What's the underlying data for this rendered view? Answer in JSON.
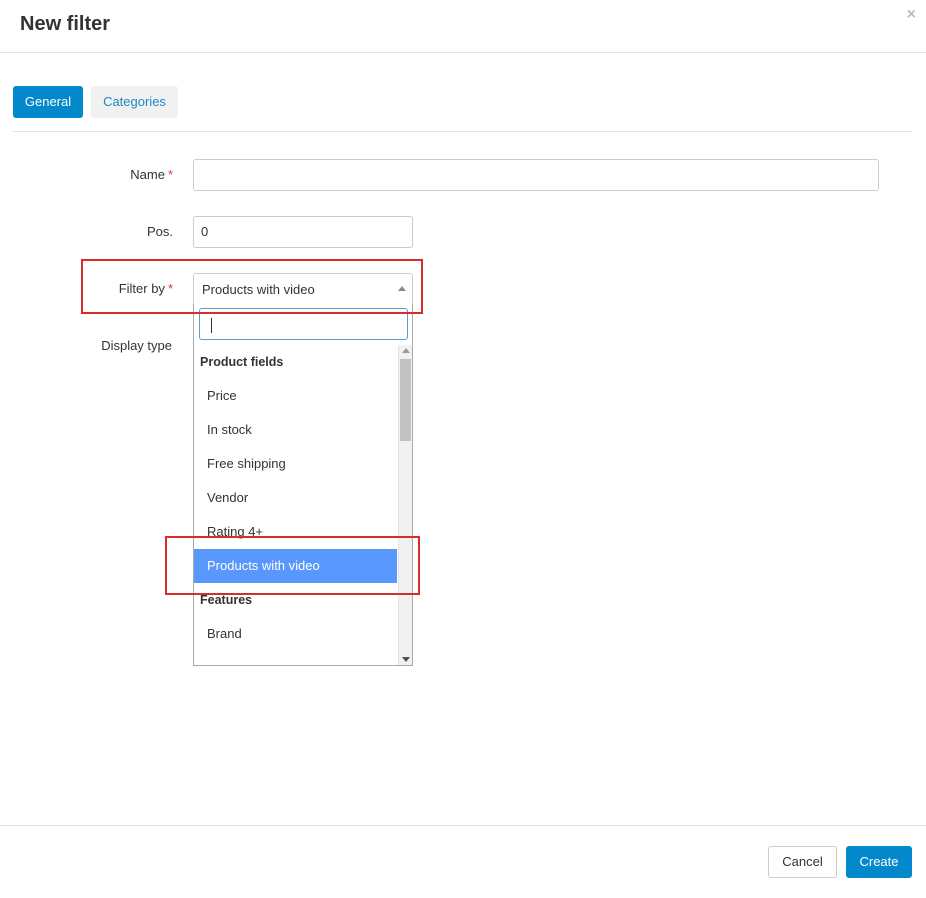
{
  "dialog": {
    "title": "New filter",
    "close_glyph": "×"
  },
  "tabs": [
    {
      "label": "General",
      "active": true
    },
    {
      "label": "Categories",
      "active": false
    }
  ],
  "form": {
    "name_label": "Name",
    "name_value": "",
    "pos_label": "Pos.",
    "pos_value": "0",
    "filter_by_label": "Filter by",
    "filter_by_value": "Products with video",
    "display_type_label": "Display type",
    "required_mark": "*"
  },
  "dropdown": {
    "search_value": "",
    "groups": [
      {
        "label": "Product fields"
      },
      {
        "label": "Features"
      }
    ],
    "items": [
      {
        "label": "Price"
      },
      {
        "label": "In stock"
      },
      {
        "label": "Free shipping"
      },
      {
        "label": "Vendor"
      },
      {
        "label": "Rating 4+"
      },
      {
        "label": "Products with video",
        "selected": true
      },
      {
        "label": "Brand"
      }
    ]
  },
  "footer": {
    "cancel_label": "Cancel",
    "create_label": "Create"
  },
  "colors": {
    "primary": "#0388cc",
    "highlight": "#5897fb",
    "annotation": "#d92c2c",
    "required": "#dd3333"
  },
  "icons": {
    "close": "close-icon",
    "select_arrow": "triangle-up-icon",
    "scroll_up": "scroll-up-arrow-icon",
    "scroll_down": "scroll-down-arrow-icon"
  }
}
